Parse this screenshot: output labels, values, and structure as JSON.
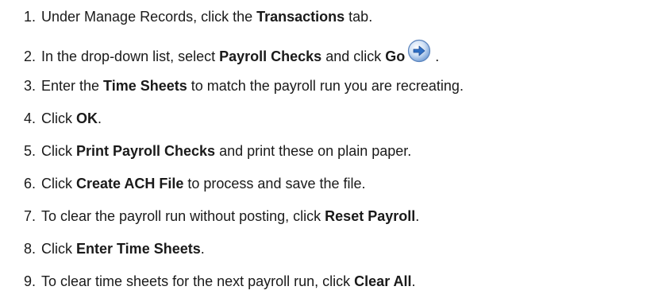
{
  "steps": [
    {
      "num": "1.",
      "pre": "Under Manage Records, click the ",
      "bold1": "Transactions",
      "mid": " tab.",
      "bold2": "",
      "post": ""
    },
    {
      "num": "2.",
      "pre": "In the drop-down list, select ",
      "bold1": "Payroll Checks",
      "mid": " and click ",
      "bold2": "Go",
      "post": " ."
    },
    {
      "num": "3.",
      "pre": "Enter the ",
      "bold1": "Time Sheets",
      "mid": " to match the payroll run you are recreating.",
      "bold2": "",
      "post": ""
    },
    {
      "num": "4.",
      "pre": "Click ",
      "bold1": "OK",
      "mid": ".",
      "bold2": "",
      "post": ""
    },
    {
      "num": "5.",
      "pre": "Click ",
      "bold1": "Print Payroll Checks",
      "mid": " and print these on plain paper.",
      "bold2": "",
      "post": ""
    },
    {
      "num": "6.",
      "pre": "Click ",
      "bold1": "Create ACH File",
      "mid": " to process and save the file.",
      "bold2": "",
      "post": ""
    },
    {
      "num": "7.",
      "pre": "To clear the payroll run without posting, click ",
      "bold1": "Reset Payroll",
      "mid": ".",
      "bold2": "",
      "post": ""
    },
    {
      "num": "8.",
      "pre": "Click ",
      "bold1": "Enter Time Sheets",
      "mid": ".",
      "bold2": "",
      "post": ""
    },
    {
      "num": "9.",
      "pre": "To clear time sheets for the next payroll run, click ",
      "bold1": "Clear All",
      "mid": ".",
      "bold2": "",
      "post": ""
    }
  ],
  "icons": {
    "go": "arrow-right-circle-icon"
  },
  "colors": {
    "text": "#1a1a1a",
    "go_icon_blue": "#2f6fc4",
    "go_icon_light": "#cfe0f5"
  }
}
